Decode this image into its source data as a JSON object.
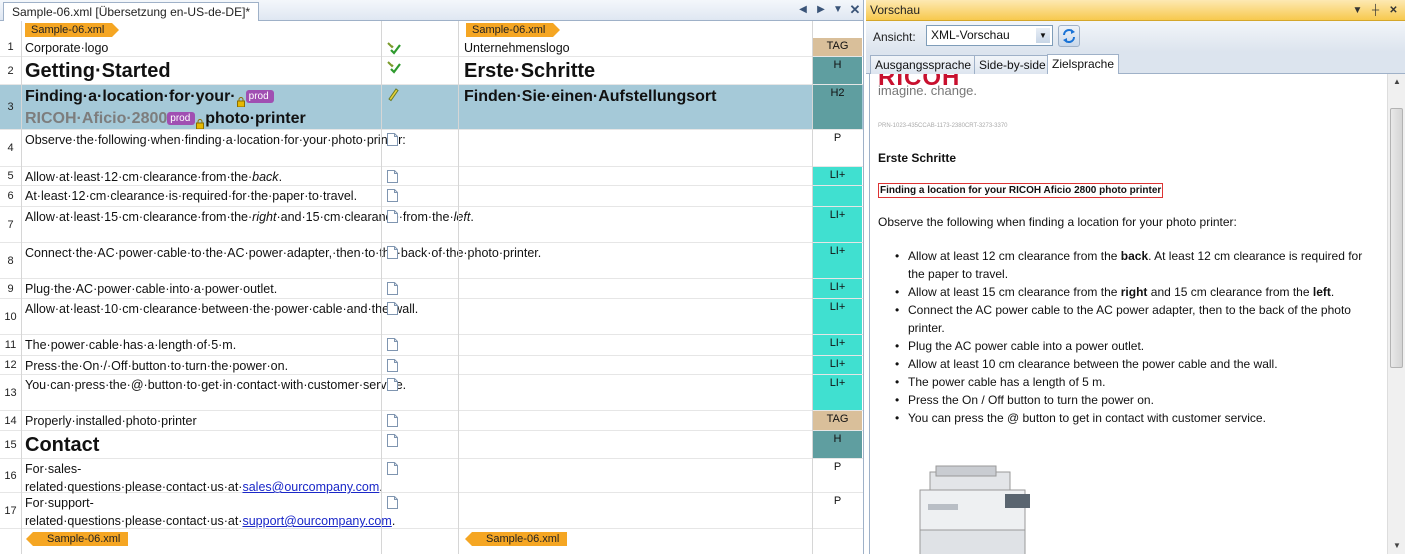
{
  "editor": {
    "tab_title": "Sample-06.xml [Übersetzung en-US-de-DE]*",
    "file_tag": "Sample-06.xml",
    "rows": [
      {
        "num": "1",
        "src": "Corporate·logo",
        "tgt": "Unternehmenslogo",
        "tag": "TAG",
        "status": "translated-check"
      },
      {
        "num": "2",
        "src": "Getting·Started",
        "tgt": "Erste·Schritte",
        "tag": "H",
        "status": "translated-check"
      },
      {
        "num": "3",
        "src_a": "Finding·a·location·for·your·",
        "src_b": "RICOH·",
        "src_c": "Aficio·2800",
        "src_d": "photo·printer",
        "tgt": "Finden·Sie·einen·Aufstellungsort",
        "tag": "H2",
        "status": "draft-pencil",
        "prod": "prod"
      },
      {
        "num": "4",
        "src": "Observe·the·following·when·finding·a·location·for·your·photo·printer:",
        "tgt": "",
        "tag": "P",
        "status": "empty"
      },
      {
        "num": "5",
        "src_a": "Allow·at·least·12·cm·clearance·from·the·",
        "src_b": "back",
        "src_c": ".",
        "tgt": "",
        "tag": "LI+",
        "status": "empty"
      },
      {
        "num": "6",
        "src": "At·least·12·cm·clearance·is·required·for·the·paper·to·travel.",
        "tgt": "",
        "tag": "",
        "status": "empty"
      },
      {
        "num": "7",
        "src_a": "Allow·at·least·15·cm·clearance·from·the·",
        "src_b": "right",
        "src_c": "·and·15·cm·clearance·from·the·",
        "src_d": "left",
        "src_e": ".",
        "tgt": "",
        "tag": "LI+",
        "status": "empty"
      },
      {
        "num": "8",
        "src": "Connect·the·AC·power·cable·to·the·AC·power·adapter,·then·to·the·back·of·the·photo·printer.",
        "tgt": "",
        "tag": "LI+",
        "status": "empty"
      },
      {
        "num": "9",
        "src": "Plug·the·AC·power·cable·into·a·power·outlet.",
        "tgt": "",
        "tag": "LI+",
        "status": "empty"
      },
      {
        "num": "10",
        "src": "Allow·at·least·10·cm·clearance·between·the·power·cable·and·the·wall.",
        "tgt": "",
        "tag": "LI+",
        "status": "empty"
      },
      {
        "num": "11",
        "src": "The·power·cable·has·a·length·of·5·m.",
        "tgt": "",
        "tag": "LI+",
        "status": "empty"
      },
      {
        "num": "12",
        "src": "Press·the·On·/·Off·button·to·turn·the·power·on.",
        "tgt": "",
        "tag": "LI+",
        "status": "empty"
      },
      {
        "num": "13",
        "src": "You·can·press·the·@·button·to·get·in·contact·with·customer·service.",
        "tgt": "",
        "tag": "LI+",
        "status": "empty"
      },
      {
        "num": "14",
        "src": "Properly·installed·photo·printer",
        "tgt": "",
        "tag": "TAG",
        "status": "empty"
      },
      {
        "num": "15",
        "src": "Contact",
        "tgt": "",
        "tag": "H",
        "status": "empty"
      },
      {
        "num": "16",
        "src_a": "For·sales-related·questions·please·contact·us·at·",
        "src_b": "sales@ourcompany.com",
        "src_c": ".",
        "tgt": "",
        "tag": "P",
        "status": "empty"
      },
      {
        "num": "17",
        "src_a": "For·support-related·questions·please·contact·us·at·",
        "src_b": "support@ourcompany.com",
        "src_c": ".",
        "tgt": "",
        "tag": "P",
        "status": "empty"
      }
    ],
    "tag_colors": {
      "TAG": "#d9bf9a",
      "H": "#5f9ea0",
      "H2": "#5f9ea0",
      "P": "#ffffff",
      "LI+": "#40e0d0"
    }
  },
  "preview": {
    "title": "Vorschau",
    "ansicht_label": "Ansicht:",
    "view_value": "XML-Vorschau",
    "tabs": [
      "Ausgangssprache",
      "Side-by-side",
      "Zielsprache"
    ],
    "active_tab": "Zielsprache",
    "logo": "RICOH",
    "slogan": "imagine. change.",
    "partno": "PRN-1023-435CCAB-1173-2380CRT-3273-3370",
    "heading": "Erste Schritte",
    "subheading": "Finding a location for your RICOH Aficio 2800 photo printer",
    "intro": "Observe the following when finding a location for your photo printer:",
    "bullets": [
      [
        "Allow at least 12 cm clearance from the ",
        "back",
        ". At least 12 cm clearance is required for the paper to travel."
      ],
      [
        "Allow at least 15 cm clearance from the ",
        "right",
        " and 15 cm clearance from the ",
        "left",
        "."
      ],
      [
        "Connect the AC power cable to the AC power adapter, then to the back of the photo printer."
      ],
      [
        "Plug the AC power cable into a power outlet."
      ],
      [
        "Allow at least 10 cm clearance between the power cable and the wall."
      ],
      [
        "The power cable has a length of 5 m."
      ],
      [
        "Press the On / Off button to turn the power on."
      ],
      [
        "You can press the @ button to get in contact with customer service."
      ]
    ]
  }
}
